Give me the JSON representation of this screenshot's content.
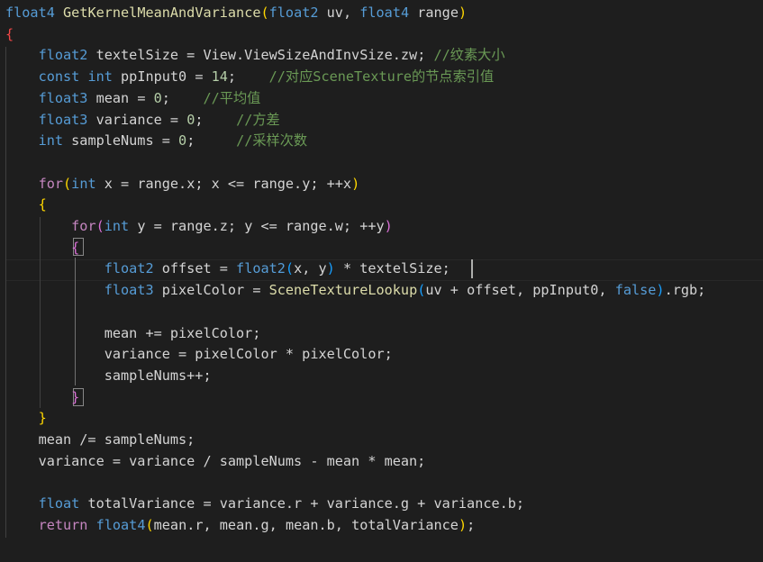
{
  "editor": {
    "colors": {
      "background": "#1e1e1e",
      "default": "#d4d4d4",
      "keyword": "#569cd6",
      "control": "#c586c0",
      "function": "#dcdcaa",
      "number": "#b5cea8",
      "comment": "#6a9955",
      "bracket_gold": "#ffd700",
      "bracket_pink": "#da70d6",
      "bracket_blue": "#179fff",
      "bracket_unmatched": "#f44747"
    },
    "lines": [
      [
        [
          "float4",
          "kw"
        ],
        [
          " ",
          ""
        ],
        [
          "GetKernelMeanAndVariance",
          "fn"
        ],
        [
          "(",
          "br-gold"
        ],
        [
          "float2",
          "kw"
        ],
        [
          " uv, ",
          ""
        ],
        [
          "float4",
          "kw"
        ],
        [
          " range",
          ""
        ],
        [
          ")",
          "br-gold"
        ]
      ],
      [
        [
          "{",
          "br-red"
        ]
      ],
      [
        [
          "    ",
          ""
        ],
        [
          "float2",
          "kw"
        ],
        [
          " textelSize = View.ViewSizeAndInvSize.zw; ",
          ""
        ],
        [
          "//纹素大小",
          "cmt"
        ]
      ],
      [
        [
          "    ",
          ""
        ],
        [
          "const",
          "kw"
        ],
        [
          " ",
          ""
        ],
        [
          "int",
          "kw"
        ],
        [
          " ppInput0 = ",
          ""
        ],
        [
          "14",
          "num"
        ],
        [
          ";    ",
          ""
        ],
        [
          "//对应SceneTexture的节点索引值",
          "cmt"
        ]
      ],
      [
        [
          "    ",
          ""
        ],
        [
          "float3",
          "kw"
        ],
        [
          " mean = ",
          ""
        ],
        [
          "0",
          "num"
        ],
        [
          ";    ",
          ""
        ],
        [
          "//平均值",
          "cmt"
        ]
      ],
      [
        [
          "    ",
          ""
        ],
        [
          "float3",
          "kw"
        ],
        [
          " variance = ",
          ""
        ],
        [
          "0",
          "num"
        ],
        [
          ";    ",
          ""
        ],
        [
          "//方差",
          "cmt"
        ]
      ],
      [
        [
          "    ",
          ""
        ],
        [
          "int",
          "kw"
        ],
        [
          " sampleNums = ",
          ""
        ],
        [
          "0",
          "num"
        ],
        [
          ";     ",
          ""
        ],
        [
          "//采样次数",
          "cmt"
        ]
      ],
      [],
      [
        [
          "    ",
          ""
        ],
        [
          "for",
          "ctrl"
        ],
        [
          "(",
          "br-gold"
        ],
        [
          "int",
          "kw"
        ],
        [
          " x = range.x; x <= range.y; ++x",
          ""
        ],
        [
          ")",
          "br-gold"
        ]
      ],
      [
        [
          "    ",
          ""
        ],
        [
          "{",
          "br-gold"
        ]
      ],
      [
        [
          "        ",
          ""
        ],
        [
          "for",
          "ctrl"
        ],
        [
          "(",
          "br-pink"
        ],
        [
          "int",
          "kw"
        ],
        [
          " y = range.z; y <= range.w; ++y",
          ""
        ],
        [
          ")",
          "br-pink"
        ]
      ],
      [
        [
          "        ",
          ""
        ],
        [
          "{",
          "br-pink"
        ]
      ],
      [
        [
          "            ",
          ""
        ],
        [
          "float2",
          "kw"
        ],
        [
          " offset = ",
          ""
        ],
        [
          "float2",
          "kw"
        ],
        [
          "(",
          "br-blue"
        ],
        [
          "x, y",
          ""
        ],
        [
          ")",
          "br-blue"
        ],
        [
          " * textelSize;",
          ""
        ]
      ],
      [
        [
          "            ",
          ""
        ],
        [
          "float3",
          "kw"
        ],
        [
          " pixelColor = ",
          ""
        ],
        [
          "SceneTextureLookup",
          "fn"
        ],
        [
          "(",
          "br-blue"
        ],
        [
          "uv + offset, ppInput0, ",
          ""
        ],
        [
          "false",
          "kw"
        ],
        [
          ")",
          "br-blue"
        ],
        [
          ".rgb;",
          ""
        ]
      ],
      [],
      [
        [
          "            mean += pixelColor;",
          ""
        ]
      ],
      [
        [
          "            variance = pixelColor * pixelColor;",
          ""
        ]
      ],
      [
        [
          "            sampleNums++;",
          ""
        ]
      ],
      [
        [
          "        ",
          ""
        ],
        [
          "}",
          "br-pink"
        ]
      ],
      [
        [
          "    ",
          ""
        ],
        [
          "}",
          "br-gold"
        ]
      ],
      [
        [
          "    mean /= sampleNums;",
          ""
        ]
      ],
      [
        [
          "    variance = variance / sampleNums - mean * mean;",
          ""
        ]
      ],
      [],
      [
        [
          "    ",
          ""
        ],
        [
          "float",
          "kw"
        ],
        [
          " totalVariance = variance.r + variance.g + variance.b;",
          ""
        ]
      ],
      [
        [
          "    ",
          ""
        ],
        [
          "return",
          "ctrl"
        ],
        [
          " ",
          ""
        ],
        [
          "float4",
          "kw"
        ],
        [
          "(",
          "br-gold"
        ],
        [
          "mean.r, mean.g, mean.b, totalVariance",
          ""
        ],
        [
          ")",
          "br-gold"
        ],
        [
          ";",
          ""
        ]
      ]
    ]
  }
}
